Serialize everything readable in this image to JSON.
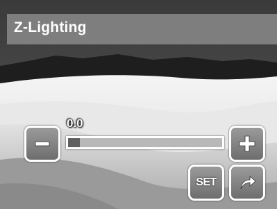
{
  "screen": {
    "title": "Z-Lighting"
  },
  "slider": {
    "value_text": "0.0",
    "level_fraction": 0.075
  },
  "buttons": {
    "decrease_icon": "minus-icon",
    "increase_icon": "plus-icon",
    "set_label": "SET",
    "return_icon": "return-arrow-icon"
  },
  "colors": {
    "button_border": "#ffffff",
    "button_fill": "#858585",
    "track": "#b8b8b8",
    "track_fill": "#5f5f5f",
    "title_bar": "#8c8c8c"
  }
}
